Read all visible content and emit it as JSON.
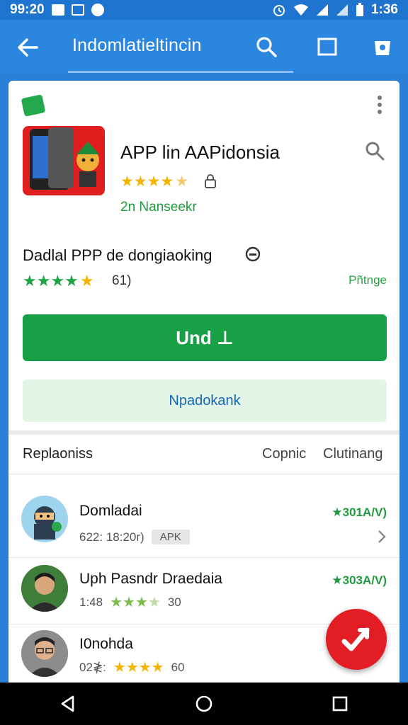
{
  "status_bar": {
    "time_left": "99:20",
    "time_right": "1:36"
  },
  "toolbar": {
    "title": "Indomlatieltincin"
  },
  "app": {
    "title": "APP  lin AAPidonsia",
    "rating_stars": 4.5,
    "subtitle": "2n Nanseekr"
  },
  "description": {
    "text": "Dadlal PPP de dongiaoking",
    "rating_stars": 5,
    "count": "61)",
    "link": "Pñtnge"
  },
  "buttons": {
    "primary": "Und ⊥",
    "secondary": "Npadokank"
  },
  "tabs": {
    "main": "Replaoniss",
    "a": "Copnic",
    "b": "Clutinang"
  },
  "list": [
    {
      "name": "Domladai",
      "meta": "622:  18:20r)",
      "tag": "APK",
      "price": "★301A/V)"
    },
    {
      "name": "Uph Pasndr Draedaia",
      "meta": "1:48",
      "stars": 3.5,
      "count": "30",
      "price": "★303A/V)"
    },
    {
      "name": "I0nohda",
      "meta": "02≹:",
      "stars": 4,
      "count": "60"
    }
  ],
  "colors": {
    "accent": "#2b86e0",
    "green": "#17a045",
    "fab": "#e21d24"
  }
}
